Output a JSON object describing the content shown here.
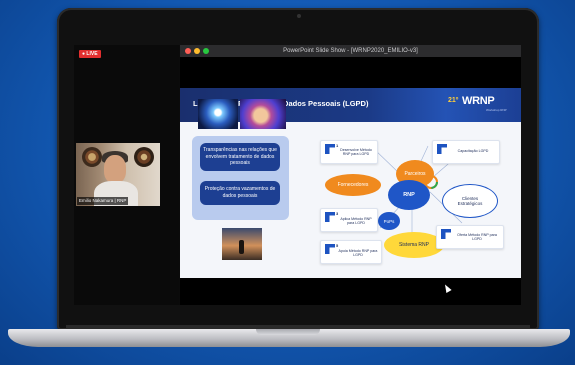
{
  "live_badge": "● LIVE",
  "participant_name": "Emilio Nakamura | RNP",
  "window_title": "PowerPoint Slide Show - [WRNP2020_EMILIO-v3]",
  "slide": {
    "title": "Lei Geral de Proteção de Dados Pessoais (LGPD)",
    "brand_number": "21º",
    "brand": "WRNP",
    "brand_sub": "Workshop RNP",
    "left_panel": {
      "item1": "Transparências nas relações que envolvem tratamento de dados pessoais",
      "item2": "Proteção contra vazamentos de dados pessoais"
    },
    "nodes": {
      "center": "RNP",
      "parceiros": "Parceiros",
      "fornecedores": "Fornecedores",
      "clientes": "Clientes Estratégicos",
      "pops": "PoPs",
      "sistema": "Sistema RNP"
    },
    "cards": {
      "card1": "Desenvolve Método RNP para LGPD",
      "card2": "Capacitação LGPD",
      "card3": "Aplica Método RNP para LGPD",
      "card4": "Oferta Método RNP para LGPD",
      "card5": "Apoia Método RNP para LGPD",
      "n1": "1",
      "n3": "3",
      "n5": "5"
    }
  },
  "colors": {
    "background": "#1257b0",
    "slide_header": "#1b3a86",
    "dark_blue": "#1d3f92",
    "orange": "#f08a1e",
    "yellow": "#ffd83a",
    "rnp_blue": "#1f56c7"
  }
}
